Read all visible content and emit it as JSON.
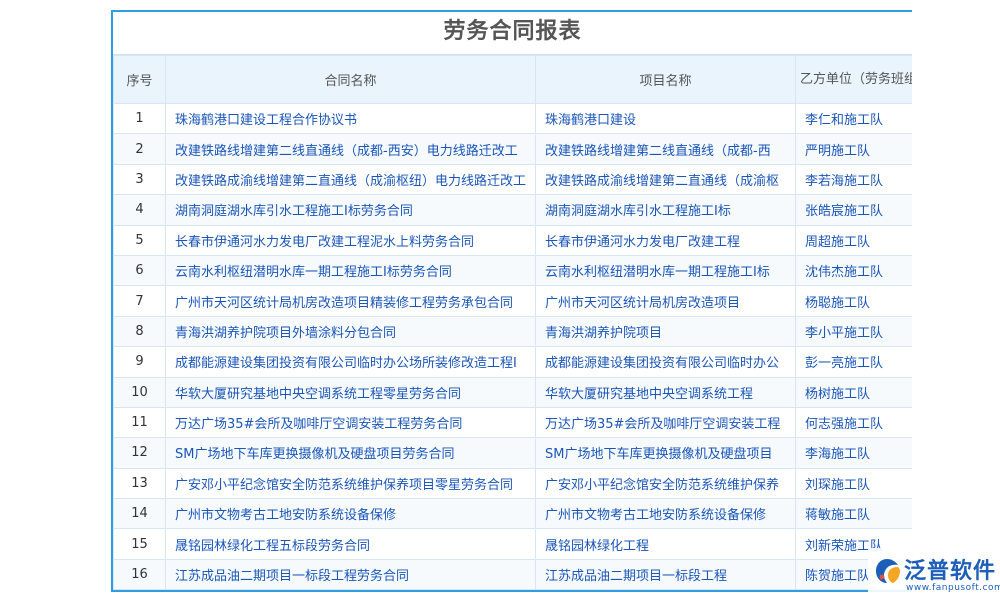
{
  "report": {
    "title": "劳务合同报表",
    "headers": {
      "index": "序号",
      "contract_name": "合同名称",
      "project_name": "项目名称",
      "party_b": "乙方单位（劳务班组）"
    },
    "rows": [
      {
        "index": "1",
        "contract_name": "珠海鹤港口建设工程合作协议书",
        "project_name": "珠海鹤港口建设",
        "party_b": "李仁和施工队"
      },
      {
        "index": "2",
        "contract_name": "改建铁路线增建第二线直通线（成都-西安）电力线路迁改工",
        "project_name": "改建铁路线增建第二线直通线（成都-西",
        "party_b": "严明施工队"
      },
      {
        "index": "3",
        "contract_name": "改建铁路成渝线增建第二直通线（成渝枢纽）电力线路迁改工",
        "project_name": "改建铁路成渝线增建第二直通线（成渝枢",
        "party_b": "李若海施工队"
      },
      {
        "index": "4",
        "contract_name": "湖南洞庭湖水库引水工程施工I标劳务合同",
        "project_name": "湖南洞庭湖水库引水工程施工I标",
        "party_b": "张皓宸施工队"
      },
      {
        "index": "5",
        "contract_name": "长春市伊通河水力发电厂改建工程泥水上料劳务合同",
        "project_name": "长春市伊通河水力发电厂改建工程",
        "party_b": "周超施工队"
      },
      {
        "index": "6",
        "contract_name": "云南水利枢纽潜明水库一期工程施工I标劳务合同",
        "project_name": "云南水利枢纽潜明水库一期工程施工I标",
        "party_b": "沈伟杰施工队"
      },
      {
        "index": "7",
        "contract_name": "广州市天河区统计局机房改造项目精装修工程劳务承包合同",
        "project_name": "广州市天河区统计局机房改造项目",
        "party_b": "杨聪施工队"
      },
      {
        "index": "8",
        "contract_name": "青海洪湖养护院项目外墙涂料分包合同",
        "project_name": "青海洪湖养护院项目",
        "party_b": "李小平施工队"
      },
      {
        "index": "9",
        "contract_name": "成都能源建设集团投资有限公司临时办公场所装修改造工程I",
        "project_name": "成都能源建设集团投资有限公司临时办公",
        "party_b": "彭一亮施工队"
      },
      {
        "index": "10",
        "contract_name": "华软大厦研究基地中央空调系统工程零星劳务合同",
        "project_name": "华软大厦研究基地中央空调系统工程",
        "party_b": "杨树施工队"
      },
      {
        "index": "11",
        "contract_name": "万达广场35#会所及咖啡厅空调安装工程劳务合同",
        "project_name": "万达广场35#会所及咖啡厅空调安装工程",
        "party_b": "何志强施工队"
      },
      {
        "index": "12",
        "contract_name": "SM广场地下车库更换摄像机及硬盘项目劳务合同",
        "project_name": "SM广场地下车库更换摄像机及硬盘项目",
        "party_b": "李海施工队"
      },
      {
        "index": "13",
        "contract_name": "广安邓小平纪念馆安全防范系统维护保养项目零星劳务合同",
        "project_name": "广安邓小平纪念馆安全防范系统维护保养",
        "party_b": "刘琛施工队"
      },
      {
        "index": "14",
        "contract_name": "广州市文物考古工地安防系统设备保修",
        "project_name": "广州市文物考古工地安防系统设备保修",
        "party_b": "蒋敏施工队"
      },
      {
        "index": "15",
        "contract_name": "晟铭园林绿化工程五标段劳务合同",
        "project_name": "晟铭园林绿化工程",
        "party_b": "刘新荣施工队"
      },
      {
        "index": "16",
        "contract_name": "江苏成品油二期项目一标段工程劳务合同",
        "project_name": "江苏成品油二期项目一标段工程",
        "party_b": "陈贺施工队"
      }
    ]
  },
  "watermark": {
    "brand": "泛普软件",
    "url": "www.fanpusoft.com",
    "icon": "fanpu-logo-icon"
  },
  "colors": {
    "border": "#2e9ee0",
    "link_text": "#1a56b8",
    "header_bg": "#e9f4fc",
    "brand": "#1d5fb8"
  }
}
